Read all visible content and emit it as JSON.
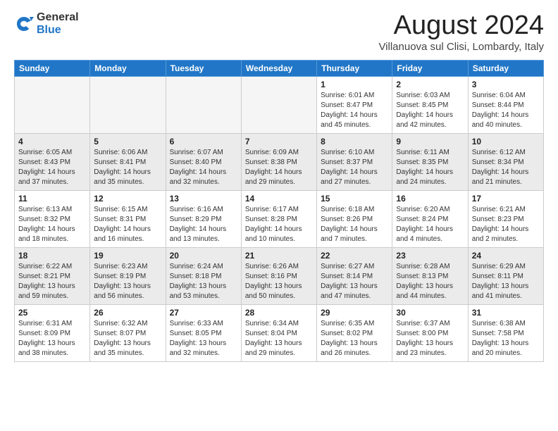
{
  "logo": {
    "general": "General",
    "blue": "Blue"
  },
  "title": "August 2024",
  "location": "Villanuova sul Clisi, Lombardy, Italy",
  "weekdays": [
    "Sunday",
    "Monday",
    "Tuesday",
    "Wednesday",
    "Thursday",
    "Friday",
    "Saturday"
  ],
  "weeks": [
    [
      {
        "day": "",
        "info": ""
      },
      {
        "day": "",
        "info": ""
      },
      {
        "day": "",
        "info": ""
      },
      {
        "day": "",
        "info": ""
      },
      {
        "day": "1",
        "info": "Sunrise: 6:01 AM\nSunset: 8:47 PM\nDaylight: 14 hours\nand 45 minutes."
      },
      {
        "day": "2",
        "info": "Sunrise: 6:03 AM\nSunset: 8:45 PM\nDaylight: 14 hours\nand 42 minutes."
      },
      {
        "day": "3",
        "info": "Sunrise: 6:04 AM\nSunset: 8:44 PM\nDaylight: 14 hours\nand 40 minutes."
      }
    ],
    [
      {
        "day": "4",
        "info": "Sunrise: 6:05 AM\nSunset: 8:43 PM\nDaylight: 14 hours\nand 37 minutes."
      },
      {
        "day": "5",
        "info": "Sunrise: 6:06 AM\nSunset: 8:41 PM\nDaylight: 14 hours\nand 35 minutes."
      },
      {
        "day": "6",
        "info": "Sunrise: 6:07 AM\nSunset: 8:40 PM\nDaylight: 14 hours\nand 32 minutes."
      },
      {
        "day": "7",
        "info": "Sunrise: 6:09 AM\nSunset: 8:38 PM\nDaylight: 14 hours\nand 29 minutes."
      },
      {
        "day": "8",
        "info": "Sunrise: 6:10 AM\nSunset: 8:37 PM\nDaylight: 14 hours\nand 27 minutes."
      },
      {
        "day": "9",
        "info": "Sunrise: 6:11 AM\nSunset: 8:35 PM\nDaylight: 14 hours\nand 24 minutes."
      },
      {
        "day": "10",
        "info": "Sunrise: 6:12 AM\nSunset: 8:34 PM\nDaylight: 14 hours\nand 21 minutes."
      }
    ],
    [
      {
        "day": "11",
        "info": "Sunrise: 6:13 AM\nSunset: 8:32 PM\nDaylight: 14 hours\nand 18 minutes."
      },
      {
        "day": "12",
        "info": "Sunrise: 6:15 AM\nSunset: 8:31 PM\nDaylight: 14 hours\nand 16 minutes."
      },
      {
        "day": "13",
        "info": "Sunrise: 6:16 AM\nSunset: 8:29 PM\nDaylight: 14 hours\nand 13 minutes."
      },
      {
        "day": "14",
        "info": "Sunrise: 6:17 AM\nSunset: 8:28 PM\nDaylight: 14 hours\nand 10 minutes."
      },
      {
        "day": "15",
        "info": "Sunrise: 6:18 AM\nSunset: 8:26 PM\nDaylight: 14 hours\nand 7 minutes."
      },
      {
        "day": "16",
        "info": "Sunrise: 6:20 AM\nSunset: 8:24 PM\nDaylight: 14 hours\nand 4 minutes."
      },
      {
        "day": "17",
        "info": "Sunrise: 6:21 AM\nSunset: 8:23 PM\nDaylight: 14 hours\nand 2 minutes."
      }
    ],
    [
      {
        "day": "18",
        "info": "Sunrise: 6:22 AM\nSunset: 8:21 PM\nDaylight: 13 hours\nand 59 minutes."
      },
      {
        "day": "19",
        "info": "Sunrise: 6:23 AM\nSunset: 8:19 PM\nDaylight: 13 hours\nand 56 minutes."
      },
      {
        "day": "20",
        "info": "Sunrise: 6:24 AM\nSunset: 8:18 PM\nDaylight: 13 hours\nand 53 minutes."
      },
      {
        "day": "21",
        "info": "Sunrise: 6:26 AM\nSunset: 8:16 PM\nDaylight: 13 hours\nand 50 minutes."
      },
      {
        "day": "22",
        "info": "Sunrise: 6:27 AM\nSunset: 8:14 PM\nDaylight: 13 hours\nand 47 minutes."
      },
      {
        "day": "23",
        "info": "Sunrise: 6:28 AM\nSunset: 8:13 PM\nDaylight: 13 hours\nand 44 minutes."
      },
      {
        "day": "24",
        "info": "Sunrise: 6:29 AM\nSunset: 8:11 PM\nDaylight: 13 hours\nand 41 minutes."
      }
    ],
    [
      {
        "day": "25",
        "info": "Sunrise: 6:31 AM\nSunset: 8:09 PM\nDaylight: 13 hours\nand 38 minutes."
      },
      {
        "day": "26",
        "info": "Sunrise: 6:32 AM\nSunset: 8:07 PM\nDaylight: 13 hours\nand 35 minutes."
      },
      {
        "day": "27",
        "info": "Sunrise: 6:33 AM\nSunset: 8:05 PM\nDaylight: 13 hours\nand 32 minutes."
      },
      {
        "day": "28",
        "info": "Sunrise: 6:34 AM\nSunset: 8:04 PM\nDaylight: 13 hours\nand 29 minutes."
      },
      {
        "day": "29",
        "info": "Sunrise: 6:35 AM\nSunset: 8:02 PM\nDaylight: 13 hours\nand 26 minutes."
      },
      {
        "day": "30",
        "info": "Sunrise: 6:37 AM\nSunset: 8:00 PM\nDaylight: 13 hours\nand 23 minutes."
      },
      {
        "day": "31",
        "info": "Sunrise: 6:38 AM\nSunset: 7:58 PM\nDaylight: 13 hours\nand 20 minutes."
      }
    ]
  ]
}
